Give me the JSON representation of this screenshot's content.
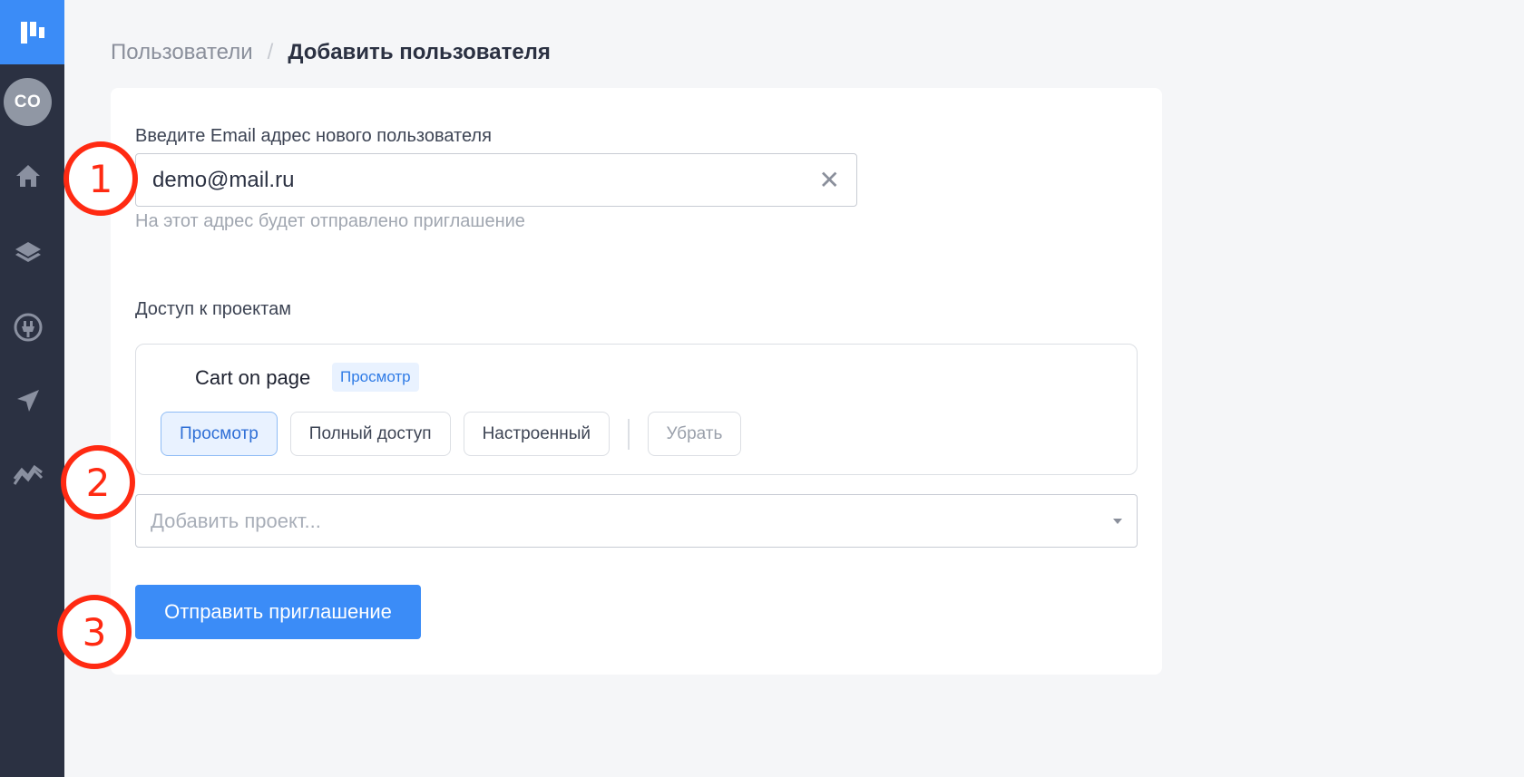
{
  "sidebar": {
    "logo_icon": "brand-logo-icon",
    "avatar_text": "CO",
    "items": [
      {
        "icon": "home-icon"
      },
      {
        "icon": "layers-icon"
      },
      {
        "icon": "plug-icon"
      },
      {
        "icon": "send-icon"
      },
      {
        "icon": "analytics-icon"
      }
    ]
  },
  "breadcrumb": {
    "parent": "Пользователи",
    "separator": "/",
    "current": "Добавить пользователя"
  },
  "form": {
    "email_label": "Введите Email адрес нового пользователя",
    "email_value": "demo@mail.ru",
    "email_hint": "На этот адрес будет отправлено приглашение",
    "access_label": "Доступ к проектам",
    "project": {
      "name": "Cart on page",
      "role_badge": "Просмотр",
      "options": [
        "Просмотр",
        "Полный доступ",
        "Настроенный"
      ],
      "selected": "Просмотр",
      "remove_label": "Убрать"
    },
    "add_project_placeholder": "Добавить проект...",
    "submit_label": "Отправить приглашение"
  },
  "callouts": [
    "1",
    "2",
    "3"
  ],
  "colors": {
    "accent": "#3b8cf7",
    "sidebar": "#2b3142",
    "callout": "#ff2a12"
  }
}
